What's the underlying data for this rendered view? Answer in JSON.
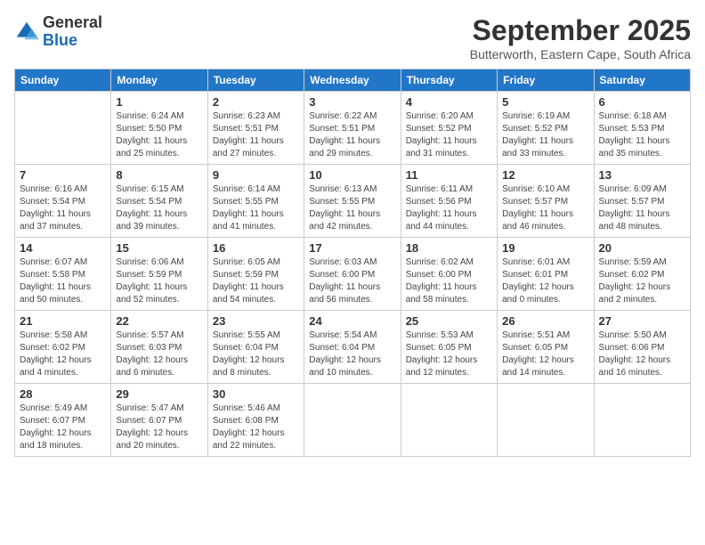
{
  "logo": {
    "general": "General",
    "blue": "Blue"
  },
  "title": "September 2025",
  "subtitle": "Butterworth, Eastern Cape, South Africa",
  "days_of_week": [
    "Sunday",
    "Monday",
    "Tuesday",
    "Wednesday",
    "Thursday",
    "Friday",
    "Saturday"
  ],
  "weeks": [
    [
      {
        "day": "",
        "info": ""
      },
      {
        "day": "1",
        "info": "Sunrise: 6:24 AM\nSunset: 5:50 PM\nDaylight: 11 hours\nand 25 minutes."
      },
      {
        "day": "2",
        "info": "Sunrise: 6:23 AM\nSunset: 5:51 PM\nDaylight: 11 hours\nand 27 minutes."
      },
      {
        "day": "3",
        "info": "Sunrise: 6:22 AM\nSunset: 5:51 PM\nDaylight: 11 hours\nand 29 minutes."
      },
      {
        "day": "4",
        "info": "Sunrise: 6:20 AM\nSunset: 5:52 PM\nDaylight: 11 hours\nand 31 minutes."
      },
      {
        "day": "5",
        "info": "Sunrise: 6:19 AM\nSunset: 5:52 PM\nDaylight: 11 hours\nand 33 minutes."
      },
      {
        "day": "6",
        "info": "Sunrise: 6:18 AM\nSunset: 5:53 PM\nDaylight: 11 hours\nand 35 minutes."
      }
    ],
    [
      {
        "day": "7",
        "info": "Sunrise: 6:16 AM\nSunset: 5:54 PM\nDaylight: 11 hours\nand 37 minutes."
      },
      {
        "day": "8",
        "info": "Sunrise: 6:15 AM\nSunset: 5:54 PM\nDaylight: 11 hours\nand 39 minutes."
      },
      {
        "day": "9",
        "info": "Sunrise: 6:14 AM\nSunset: 5:55 PM\nDaylight: 11 hours\nand 41 minutes."
      },
      {
        "day": "10",
        "info": "Sunrise: 6:13 AM\nSunset: 5:55 PM\nDaylight: 11 hours\nand 42 minutes."
      },
      {
        "day": "11",
        "info": "Sunrise: 6:11 AM\nSunset: 5:56 PM\nDaylight: 11 hours\nand 44 minutes."
      },
      {
        "day": "12",
        "info": "Sunrise: 6:10 AM\nSunset: 5:57 PM\nDaylight: 11 hours\nand 46 minutes."
      },
      {
        "day": "13",
        "info": "Sunrise: 6:09 AM\nSunset: 5:57 PM\nDaylight: 11 hours\nand 48 minutes."
      }
    ],
    [
      {
        "day": "14",
        "info": "Sunrise: 6:07 AM\nSunset: 5:58 PM\nDaylight: 11 hours\nand 50 minutes."
      },
      {
        "day": "15",
        "info": "Sunrise: 6:06 AM\nSunset: 5:59 PM\nDaylight: 11 hours\nand 52 minutes."
      },
      {
        "day": "16",
        "info": "Sunrise: 6:05 AM\nSunset: 5:59 PM\nDaylight: 11 hours\nand 54 minutes."
      },
      {
        "day": "17",
        "info": "Sunrise: 6:03 AM\nSunset: 6:00 PM\nDaylight: 11 hours\nand 56 minutes."
      },
      {
        "day": "18",
        "info": "Sunrise: 6:02 AM\nSunset: 6:00 PM\nDaylight: 11 hours\nand 58 minutes."
      },
      {
        "day": "19",
        "info": "Sunrise: 6:01 AM\nSunset: 6:01 PM\nDaylight: 12 hours\nand 0 minutes."
      },
      {
        "day": "20",
        "info": "Sunrise: 5:59 AM\nSunset: 6:02 PM\nDaylight: 12 hours\nand 2 minutes."
      }
    ],
    [
      {
        "day": "21",
        "info": "Sunrise: 5:58 AM\nSunset: 6:02 PM\nDaylight: 12 hours\nand 4 minutes."
      },
      {
        "day": "22",
        "info": "Sunrise: 5:57 AM\nSunset: 6:03 PM\nDaylight: 12 hours\nand 6 minutes."
      },
      {
        "day": "23",
        "info": "Sunrise: 5:55 AM\nSunset: 6:04 PM\nDaylight: 12 hours\nand 8 minutes."
      },
      {
        "day": "24",
        "info": "Sunrise: 5:54 AM\nSunset: 6:04 PM\nDaylight: 12 hours\nand 10 minutes."
      },
      {
        "day": "25",
        "info": "Sunrise: 5:53 AM\nSunset: 6:05 PM\nDaylight: 12 hours\nand 12 minutes."
      },
      {
        "day": "26",
        "info": "Sunrise: 5:51 AM\nSunset: 6:05 PM\nDaylight: 12 hours\nand 14 minutes."
      },
      {
        "day": "27",
        "info": "Sunrise: 5:50 AM\nSunset: 6:06 PM\nDaylight: 12 hours\nand 16 minutes."
      }
    ],
    [
      {
        "day": "28",
        "info": "Sunrise: 5:49 AM\nSunset: 6:07 PM\nDaylight: 12 hours\nand 18 minutes."
      },
      {
        "day": "29",
        "info": "Sunrise: 5:47 AM\nSunset: 6:07 PM\nDaylight: 12 hours\nand 20 minutes."
      },
      {
        "day": "30",
        "info": "Sunrise: 5:46 AM\nSunset: 6:08 PM\nDaylight: 12 hours\nand 22 minutes."
      },
      {
        "day": "",
        "info": ""
      },
      {
        "day": "",
        "info": ""
      },
      {
        "day": "",
        "info": ""
      },
      {
        "day": "",
        "info": ""
      }
    ]
  ]
}
